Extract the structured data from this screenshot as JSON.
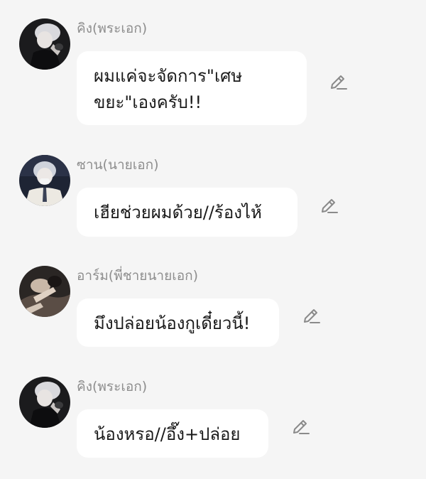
{
  "messages": [
    {
      "sender": "คิง(พระเอก)",
      "lines": [
        "ผมแค่จะจัดการ\"เศษ",
        "ขยะ\"เองครับ!!"
      ],
      "avatar": "avatar-king"
    },
    {
      "sender": "ซาน(นายเอก)",
      "lines": [
        "เฮียช่วยผมด้วย//ร้องไห้"
      ],
      "avatar": "avatar-san"
    },
    {
      "sender": "อาร์ม(พี่ชายนายเอก)",
      "lines": [
        "มึงปล่อยน้องกูเดี๋ยวนี้!"
      ],
      "avatar": "avatar-arm"
    },
    {
      "sender": "คิง(พระเอก)",
      "lines": [
        "น้องหรอ//อึ๊ง+ปล่อย"
      ],
      "avatar": "avatar-king"
    }
  ],
  "icons": {
    "edit": "pencil-edit-icon"
  },
  "colors": {
    "background": "#f5f5f5",
    "bubble": "#ffffff",
    "sender_text": "#8e8e8e",
    "message_text": "#1a1a1a",
    "icon": "#8a8a8a"
  }
}
